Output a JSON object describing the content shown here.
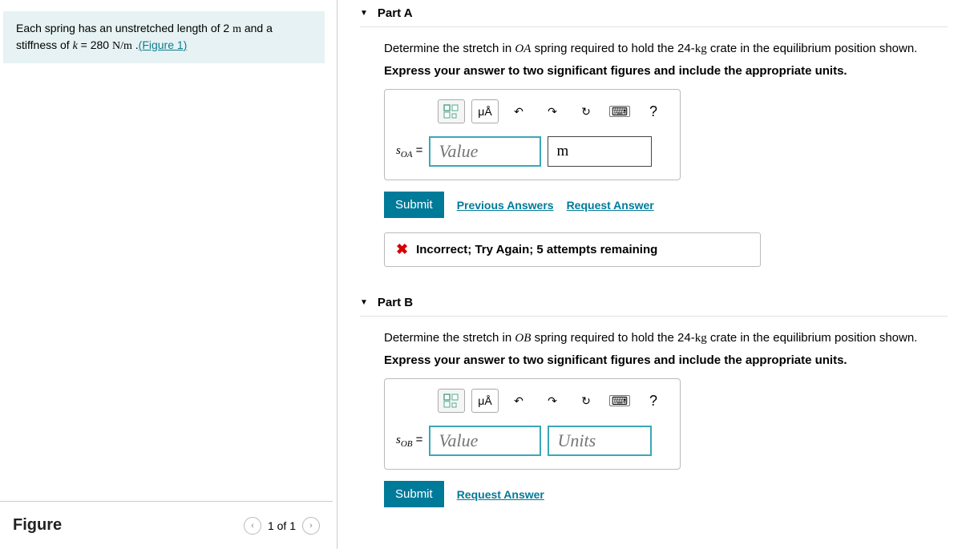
{
  "problem": {
    "text_pre": "Each spring has an unstretched length of 2 ",
    "unit1": "m",
    "text_mid": " and a stiffness of ",
    "k_var": "k",
    "eq": " = 280 ",
    "unit2": "N/m",
    "text_post": " .",
    "figure_link": "(Figure 1)"
  },
  "figure": {
    "title": "Figure",
    "pager": "1 of 1"
  },
  "partA": {
    "header": "Part A",
    "prompt_pre": "Determine the stretch in ",
    "prompt_var": "OA",
    "prompt_mid": " spring required to hold the 24-",
    "prompt_unit": "kg",
    "prompt_post": " crate in the equilibrium position shown.",
    "instruction": "Express your answer to two significant figures and include the appropriate units.",
    "label_html": "s",
    "label_sub": "OA",
    "eq_sign": " =",
    "value_placeholder": "Value",
    "units_value": "m",
    "submit": "Submit",
    "prev_answers": "Previous Answers",
    "request_answer": "Request Answer",
    "feedback": "Incorrect; Try Again; 5 attempts remaining",
    "tool_mu": "μÅ",
    "tool_help": "?"
  },
  "partB": {
    "header": "Part B",
    "prompt_pre": "Determine the stretch in ",
    "prompt_var": "OB",
    "prompt_mid": " spring required to hold the 24-",
    "prompt_unit": "kg",
    "prompt_post": " crate in the equilibrium position shown.",
    "instruction": "Express your answer to two significant figures and include the appropriate units.",
    "label_html": "s",
    "label_sub": "OB",
    "eq_sign": " =",
    "value_placeholder": "Value",
    "units_placeholder": "Units",
    "submit": "Submit",
    "request_answer": "Request Answer",
    "tool_mu": "μÅ",
    "tool_help": "?"
  }
}
